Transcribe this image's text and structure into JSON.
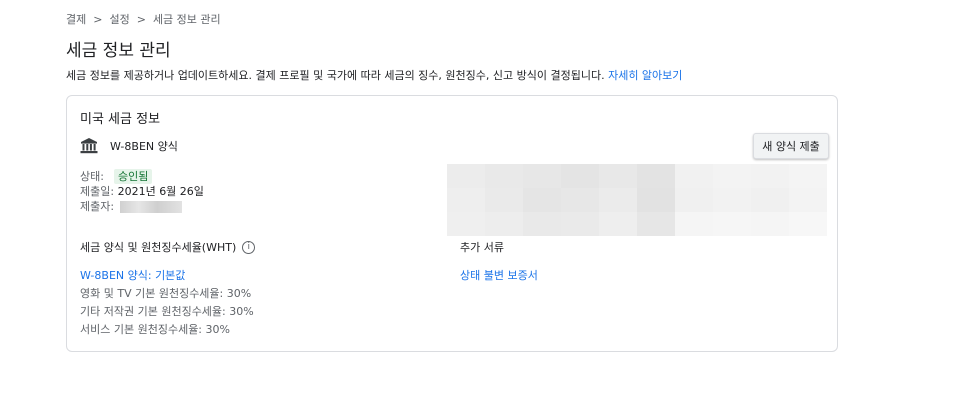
{
  "breadcrumb": {
    "items": [
      "결제",
      "설정",
      "세금 정보 관리"
    ],
    "separator": ">"
  },
  "page_title": "세금 정보 관리",
  "intro": {
    "text": "세금 정보를 제공하거나 업데이트하세요. 결제 프로필 및 국가에 따라 세금의 징수, 원천징수, 신고 방식이 결정됩니다.",
    "link": "자세히 알아보기"
  },
  "card": {
    "title": "미국 세금 정보",
    "form_icon": "bank-icon",
    "form_name": "W-8BEN 양식",
    "submit_label": "새 양식 제출",
    "status_label": "상태:",
    "status_value": "승인됨",
    "submitted_date_label": "제출일:",
    "submitted_date_value": "2021년 6월 26일",
    "submitter_label": "제출자:",
    "wht_header": "세금 양식 및 원천징수세율(WHT)",
    "wht_form_link": "W-8BEN 양식: 기본값",
    "wht_rates": [
      "영화 및 TV 기본 원천징수세율: 30%",
      "기타 저작권 기본 원천징수세율: 30%",
      "서비스 기본 원천징수세율: 30%"
    ],
    "extra_docs_header": "추가 서류",
    "extra_docs_link": "상태 불변 보증서"
  },
  "colors": {
    "accent": "#1a73e8",
    "status_bg": "#e6f4ea",
    "status_fg": "#137333"
  }
}
